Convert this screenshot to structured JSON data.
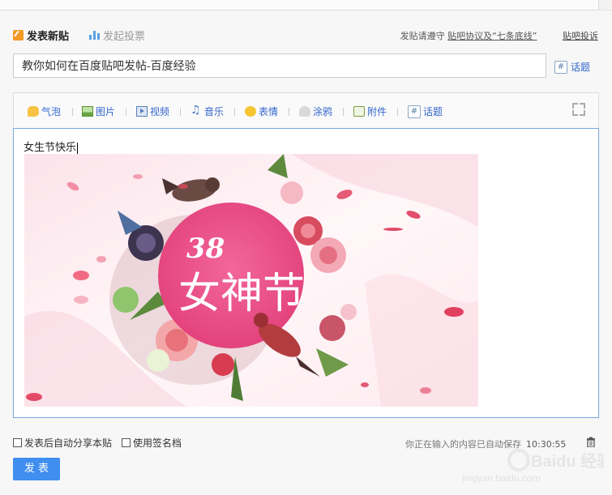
{
  "tabs": {
    "new_post": "发表新贴",
    "vote": "发起投票"
  },
  "notice": {
    "prefix": "发贴请遵守",
    "agreement_link": "贴吧协议及“七条底线”",
    "complain_link": "贴吧投诉"
  },
  "title_input": {
    "value": "教你如何在百度贴吧发帖-百度经验"
  },
  "topic_link": "话题",
  "toolbar": {
    "items": [
      "气泡",
      "图片",
      "视频",
      "音乐",
      "表情",
      "涂鸦",
      "附件",
      "话题"
    ]
  },
  "editor": {
    "text": "女生节快乐",
    "banner": {
      "number": "38",
      "title": "女神节"
    }
  },
  "options": {
    "auto_share": "发表后自动分享本贴",
    "use_signature": "使用签名档"
  },
  "autosave": {
    "message": "你正在输入的内容已自动保存",
    "time": "10:30:55"
  },
  "publish_button": "发 表",
  "watermark": {
    "brand": "Baidu 经验",
    "url": "jingyan.baidu.com"
  },
  "colors": {
    "accent": "#3f8ef0",
    "link": "#3366cc",
    "banner_circle": "#e9467f"
  }
}
